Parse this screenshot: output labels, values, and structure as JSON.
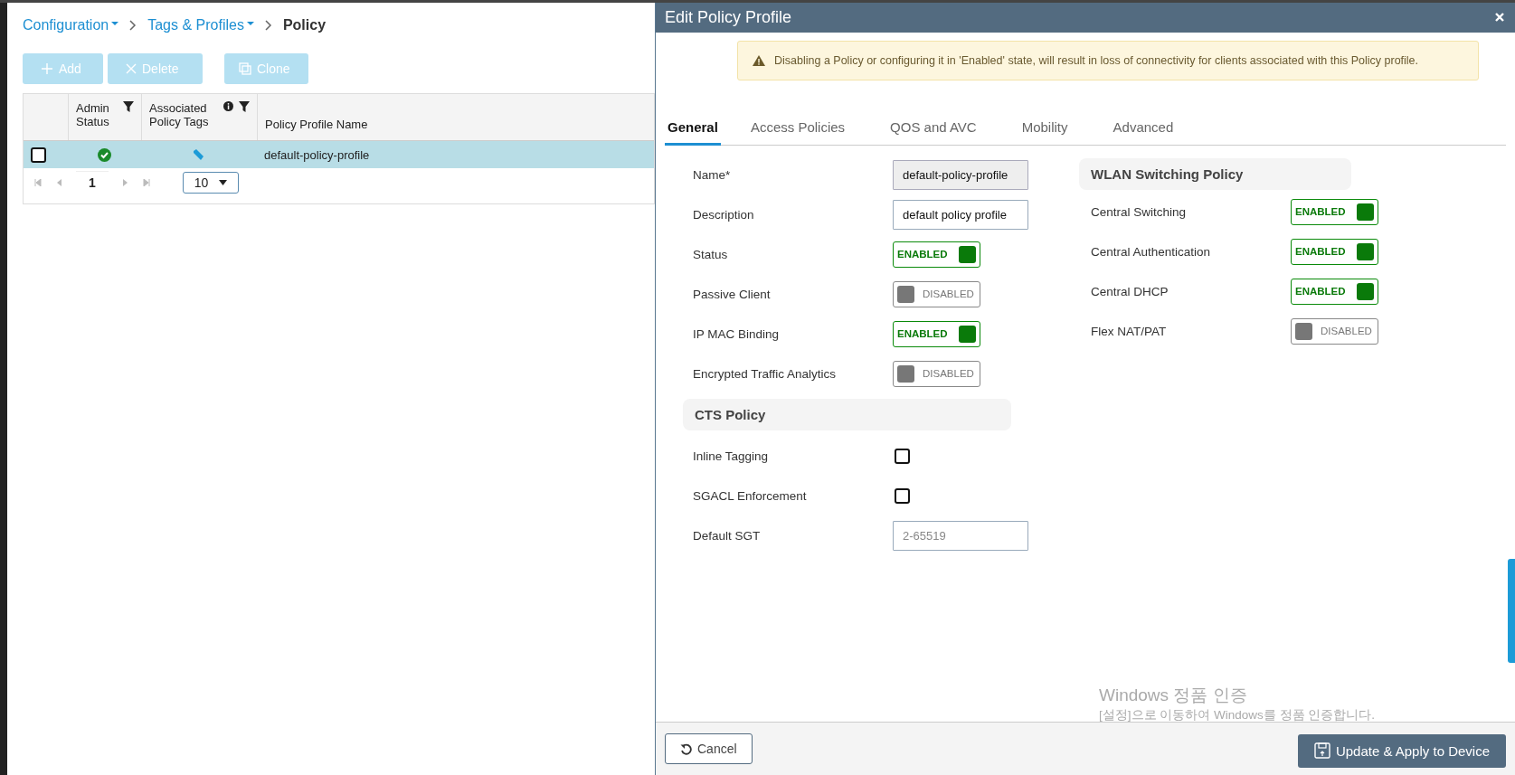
{
  "breadcrumb": [
    {
      "label": "Configuration",
      "dropdown": true
    },
    {
      "label": "Tags & Profiles",
      "dropdown": true
    },
    {
      "label": "Policy",
      "dropdown": false
    }
  ],
  "toolbar": [
    {
      "label": "Add",
      "kind": "add",
      "disabled": true
    },
    {
      "label": "Delete",
      "kind": "delete",
      "disabled": true
    },
    {
      "label": "Clone",
      "kind": "clone",
      "disabled": true
    }
  ],
  "table": {
    "columns": [
      {
        "label": "Admin Status",
        "filter": true,
        "info": false
      },
      {
        "label": "Associated Policy Tags",
        "filter": true,
        "info": true
      },
      {
        "label": "Policy Profile Name",
        "filter": false,
        "info": false
      }
    ],
    "rows": [
      {
        "checked": false,
        "selected": true,
        "admin_enabled": true,
        "name": "default-policy-profile"
      }
    ],
    "pager": {
      "page": "1",
      "page_size": "10"
    }
  },
  "modal": {
    "title": "Edit Policy Profile",
    "warning": "Disabling a Policy or configuring it in 'Enabled' state, will result in loss of connectivity for clients associated with this Policy profile.",
    "tabs": [
      {
        "label": "General",
        "selected": true
      },
      {
        "label": "Access Policies",
        "selected": false
      },
      {
        "label": "QOS and AVC",
        "selected": false
      },
      {
        "label": "Mobility",
        "selected": false
      },
      {
        "label": "Advanced",
        "selected": false
      }
    ],
    "left_fields": [
      {
        "label": "Name*",
        "kind": "text",
        "value": "default-policy-profile",
        "disabled": true
      },
      {
        "label": "Description",
        "kind": "text",
        "value": "default policy profile",
        "disabled": false
      },
      {
        "label": "Status",
        "kind": "toggle",
        "on": true,
        "text": "ENABLED"
      },
      {
        "label": "Passive Client",
        "kind": "toggle",
        "on": false,
        "text": "DISABLED"
      },
      {
        "label": "IP MAC Binding",
        "kind": "toggle",
        "on": true,
        "text": "ENABLED"
      },
      {
        "label": "Encrypted Traffic Analytics",
        "kind": "toggle",
        "on": false,
        "text": "DISABLED"
      }
    ],
    "cts": {
      "title": "CTS Policy",
      "fields": [
        {
          "label": "Inline Tagging",
          "kind": "checkbox",
          "checked": false
        },
        {
          "label": "SGACL Enforcement",
          "kind": "checkbox",
          "checked": false
        },
        {
          "label": "Default SGT",
          "kind": "text",
          "placeholder": "2-65519",
          "disabled": false
        }
      ]
    },
    "wlan": {
      "title": "WLAN Switching Policy",
      "fields": [
        {
          "label": "Central Switching",
          "kind": "toggle",
          "on": true,
          "text": "ENABLED"
        },
        {
          "label": "Central Authentication",
          "kind": "toggle",
          "on": true,
          "text": "ENABLED"
        },
        {
          "label": "Central DHCP",
          "kind": "toggle",
          "on": true,
          "text": "ENABLED"
        },
        {
          "label": "Flex NAT/PAT",
          "kind": "toggle",
          "on": false,
          "text": "DISABLED"
        }
      ]
    },
    "buttons": [
      {
        "label": "Cancel",
        "kind": "cancel"
      },
      {
        "label": "Update & Apply to Device",
        "kind": "apply"
      }
    ]
  },
  "os_notice": {
    "title": "Windows 정품 인증",
    "text": "[설정]으로 이동하여 Windows를 정품 인증합니다."
  }
}
